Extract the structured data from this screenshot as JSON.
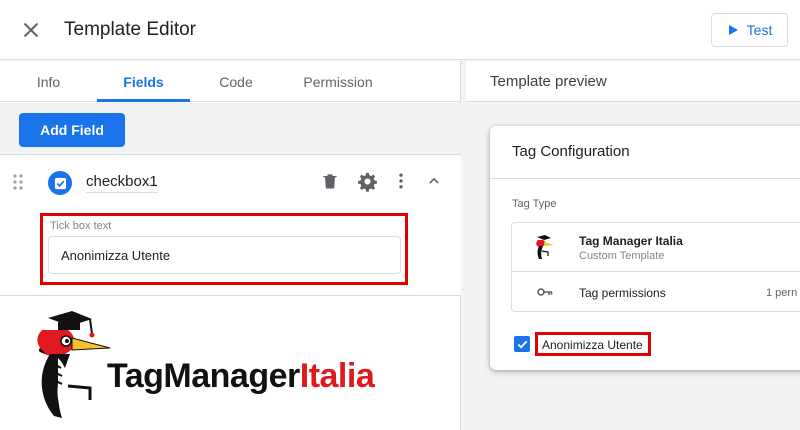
{
  "header": {
    "title": "Template Editor",
    "test_label": "Test"
  },
  "tabs": [
    {
      "label": "Info",
      "active": false
    },
    {
      "label": "Fields",
      "active": true
    },
    {
      "label": "Code",
      "active": false
    },
    {
      "label": "Permission",
      "active": false
    }
  ],
  "toolbar": {
    "add_field_label": "Add Field"
  },
  "field": {
    "name": "checkbox1",
    "icons": [
      "drag-handle-icon",
      "checkbox-icon",
      "delete-icon",
      "gear-icon",
      "more-vert-icon",
      "chevron-up-icon"
    ],
    "tick_box_text_label": "Tick box text",
    "tick_box_text_value": "Anonimizza Utente"
  },
  "logo": {
    "part1": "TagManager",
    "part2": "Italia"
  },
  "preview": {
    "title": "Template preview",
    "card_title": "Tag Configuration",
    "tag_type_label": "Tag Type",
    "tag_name": "Tag Manager Italia",
    "tag_subtitle": "Custom Template",
    "permissions_label": "Tag permissions",
    "permissions_count": "1 pern",
    "checkbox_label": "Anonimizza Utente",
    "checkbox_checked": true
  },
  "colors": {
    "accent": "#1a73e8",
    "highlight_border": "#e00000",
    "logo_red": "#e0191e"
  }
}
